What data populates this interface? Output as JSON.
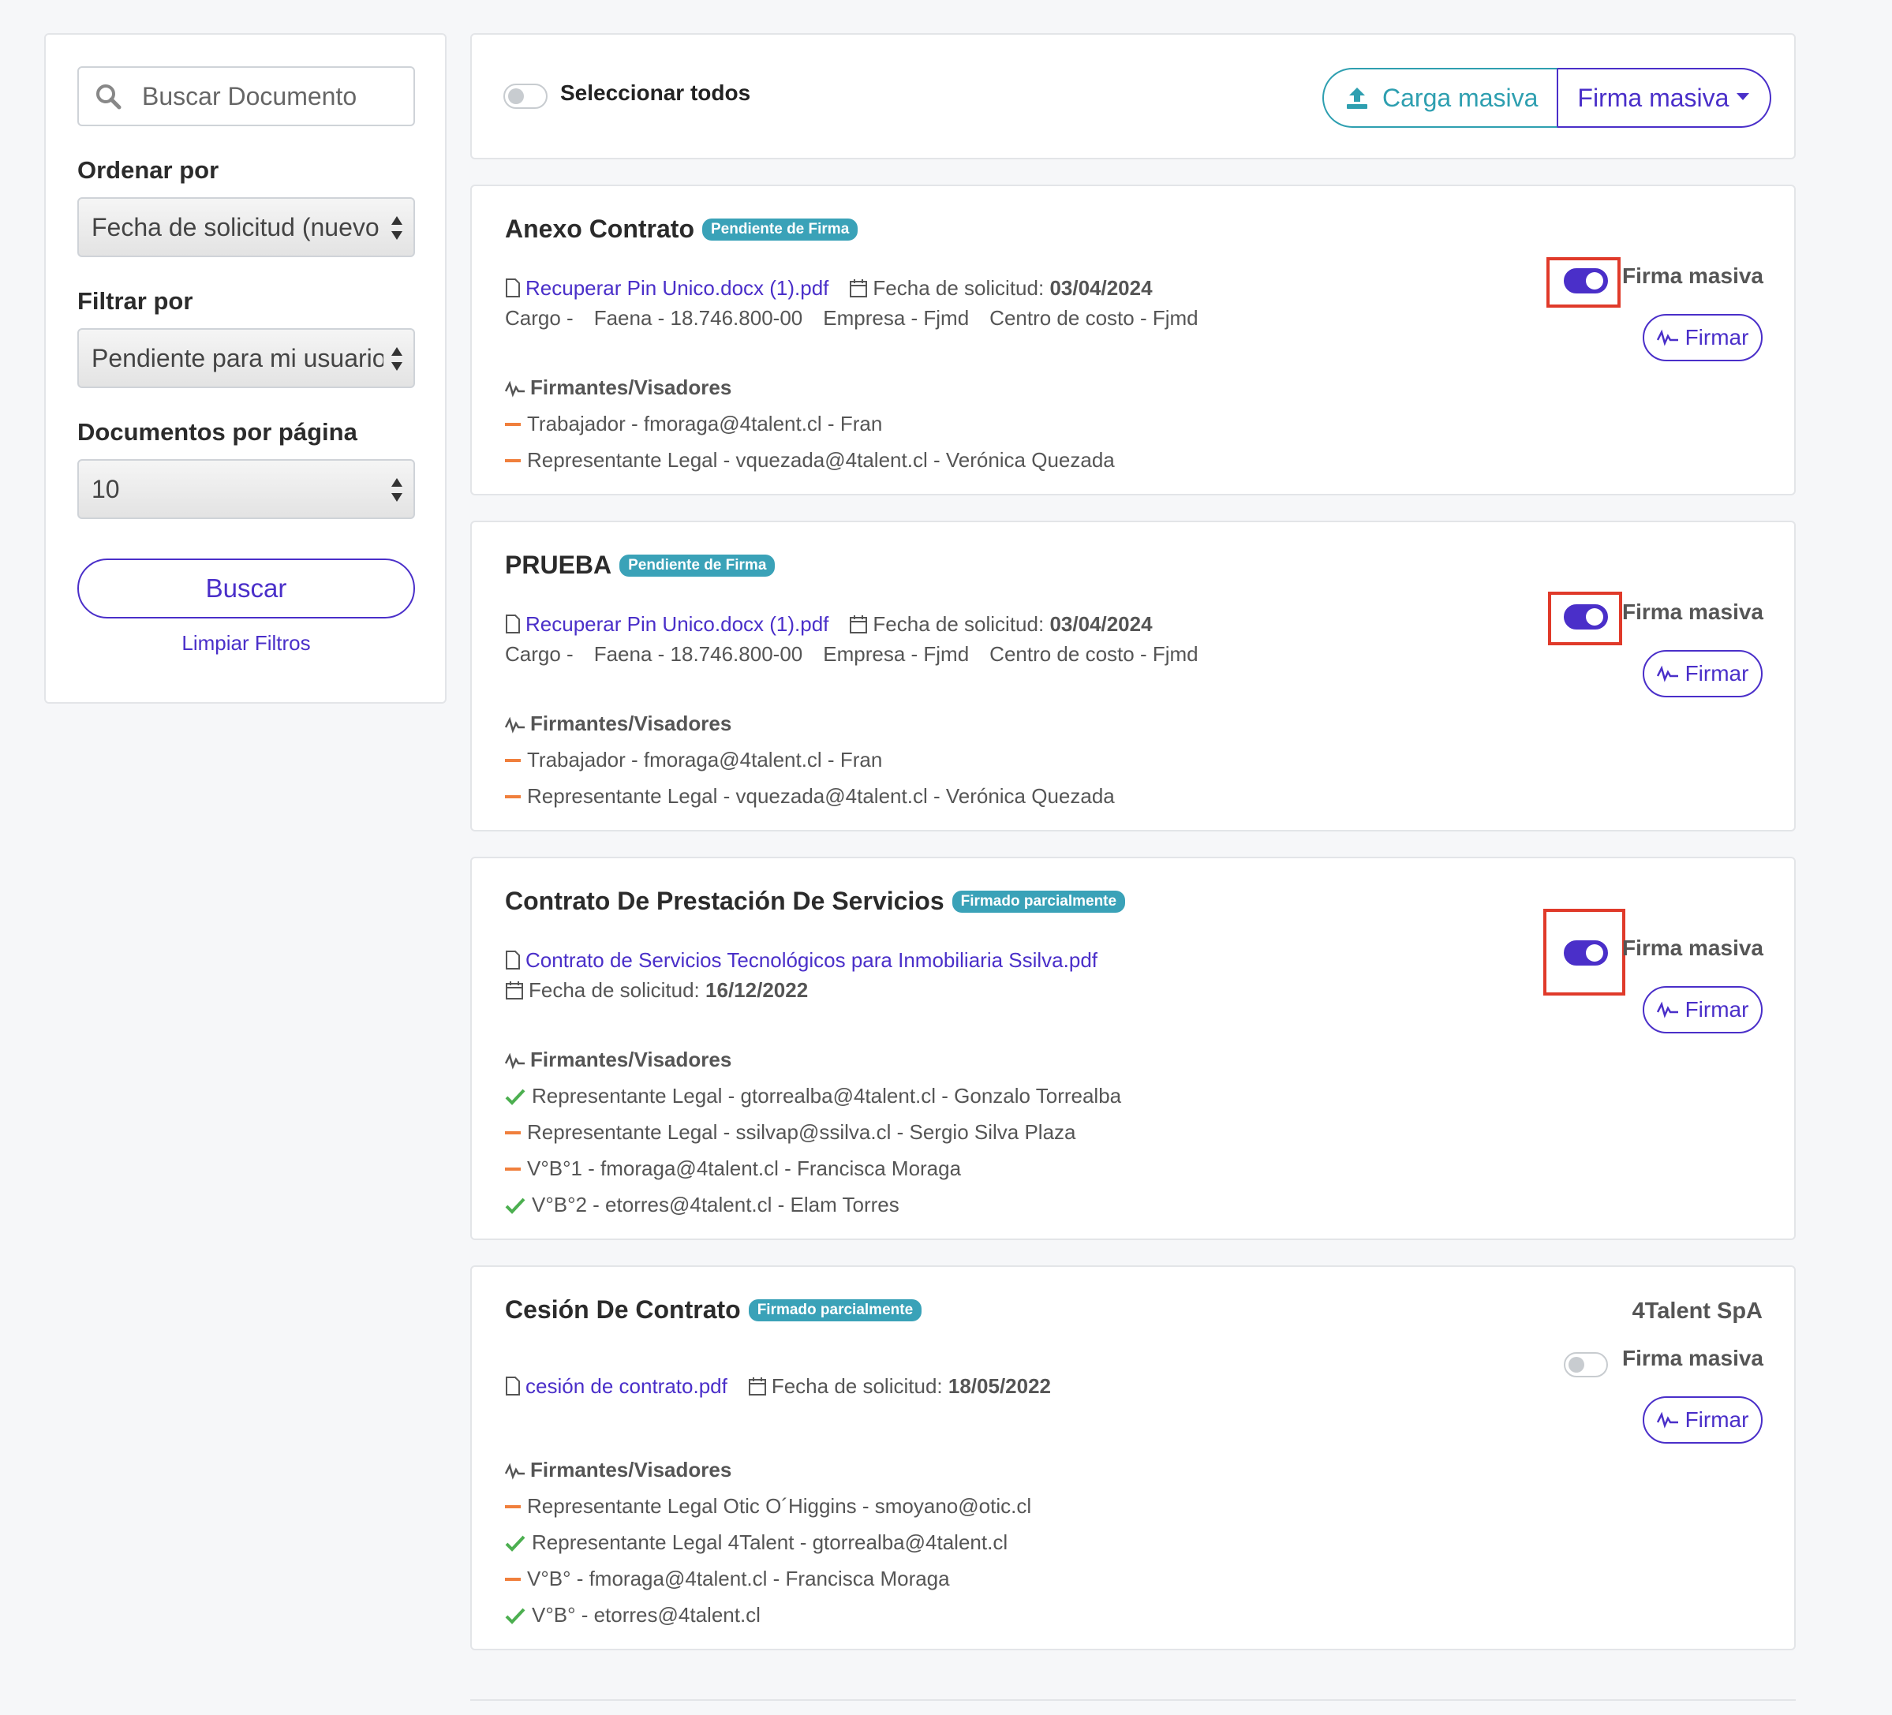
{
  "sidebar": {
    "search_placeholder": "Buscar Documento",
    "order_label": "Ordenar por",
    "order_value": "Fecha de solicitud (nuevo",
    "filter_label": "Filtrar por",
    "filter_value": "Pendiente para mi usuario",
    "per_page_label": "Documentos por página",
    "per_page_value": "10",
    "search_button": "Buscar",
    "clear_link": "Limpiar Filtros"
  },
  "topbar": {
    "select_all_label": "Seleccionar todos",
    "bulk_upload_label": "Carga masiva",
    "bulk_sign_label": "Firma masiva"
  },
  "colors": {
    "accent": "#4a2fc9",
    "teal": "#2e9fb0",
    "badge": "#3aa2b8",
    "pending_dash": "#f07f3c",
    "signed_check": "#4caf50",
    "highlight": "#e03a2a"
  },
  "signers_heading": "Firmantes/Visadores",
  "firma_masiva_label": "Firma masiva",
  "firmar_label": "Firmar",
  "documents": [
    {
      "title": "Anexo Contrato",
      "status": "Pendiente de Firma",
      "file": "Recuperar Pin Unico.docx (1).pdf",
      "date_label": "Fecha de solicitud:",
      "date": "03/04/2024",
      "details": [
        "Cargo -",
        "Faena - 18.746.800-00",
        "Empresa - Fjmd",
        "Centro de costo - Fjmd"
      ],
      "bulk_sign_on": true,
      "signers": [
        {
          "state": "pending",
          "text": "Trabajador - fmoraga@4talent.cl - Fran"
        },
        {
          "state": "pending",
          "text": "Representante Legal - vquezada@4talent.cl - Verónica Quezada"
        }
      ]
    },
    {
      "title": "PRUEBA",
      "status": "Pendiente de Firma",
      "file": "Recuperar Pin Unico.docx (1).pdf",
      "date_label": "Fecha de solicitud:",
      "date": "03/04/2024",
      "details": [
        "Cargo -",
        "Faena - 18.746.800-00",
        "Empresa - Fjmd",
        "Centro de costo - Fjmd"
      ],
      "bulk_sign_on": true,
      "signers": [
        {
          "state": "pending",
          "text": "Trabajador - fmoraga@4talent.cl - Fran"
        },
        {
          "state": "pending",
          "text": "Representante Legal - vquezada@4talent.cl - Verónica Quezada"
        }
      ]
    },
    {
      "title": "Contrato De Prestación De Servicios",
      "status": "Firmado parcialmente",
      "file": "Contrato de Servicios Tecnológicos para Inmobiliaria Ssilva.pdf",
      "date_label": "Fecha de solicitud:",
      "date": "16/12/2022",
      "bulk_sign_on": true,
      "signers": [
        {
          "state": "signed",
          "text": "Representante Legal - gtorrealba@4talent.cl - Gonzalo Torrealba"
        },
        {
          "state": "pending",
          "text": "Representante Legal - ssilvap@ssilva.cl - Sergio Silva Plaza"
        },
        {
          "state": "pending",
          "text": "V°B°1 - fmoraga@4talent.cl - Francisca Moraga"
        },
        {
          "state": "signed",
          "text": "V°B°2 - etorres@4talent.cl - Elam Torres"
        }
      ]
    },
    {
      "title": "Cesión De Contrato",
      "status": "Firmado parcialmente",
      "company": "4Talent SpA",
      "file": "cesión de contrato.pdf",
      "date_label": "Fecha de solicitud:",
      "date": "18/05/2022",
      "bulk_sign_on": false,
      "signers": [
        {
          "state": "pending",
          "text": "Representante Legal Otic O´Higgins - smoyano@otic.cl"
        },
        {
          "state": "signed",
          "text": "Representante Legal 4Talent - gtorrealba@4talent.cl"
        },
        {
          "state": "pending",
          "text": "V°B° - fmoraga@4talent.cl - Francisca Moraga"
        },
        {
          "state": "signed",
          "text": "V°B° - etorres@4talent.cl"
        }
      ]
    }
  ]
}
